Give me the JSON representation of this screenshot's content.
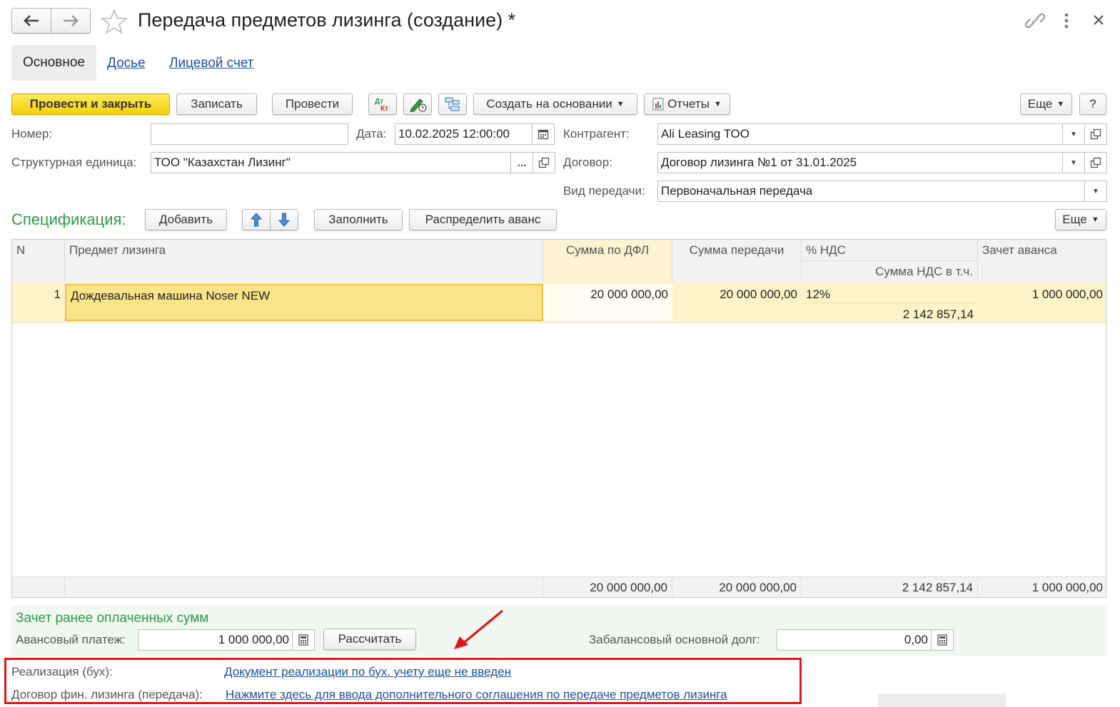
{
  "window": {
    "title": "Передача предметов лизинга (создание) *"
  },
  "tabs": [
    {
      "label": "Основное"
    },
    {
      "label": "Досье"
    },
    {
      "label": "Лицевой счет"
    }
  ],
  "toolbar": {
    "post_close": "Провести и закрыть",
    "save": "Записать",
    "post": "Провести",
    "create_based": "Создать на основании",
    "reports": "Отчеты",
    "more": "Еще",
    "help": "?"
  },
  "form": {
    "number_label": "Номер:",
    "number_value": "",
    "date_label": "Дата:",
    "date_value": "10.02.2025 12:00:00",
    "unit_label": "Структурная единица:",
    "unit_value": "ТОО \"Казахстан Лизинг\"",
    "counterparty_label": "Контрагент:",
    "counterparty_value": "Ali Leasing ТОО",
    "contract_label": "Договор:",
    "contract_value": "Договор лизинга №1 от 31.01.2025",
    "transfer_type_label": "Вид передачи:",
    "transfer_type_value": "Первоначальная передача"
  },
  "spec": {
    "title": "Спецификация:",
    "add": "Добавить",
    "fill": "Заполнить",
    "distribute": "Распределить аванс",
    "more": "Еще",
    "columns": {
      "n": "N",
      "item": "Предмет лизинга",
      "dfl": "Сумма по ДФЛ",
      "transfer": "Сумма передачи",
      "vat_pct": "% НДС",
      "vat_sum": "Сумма НДС в т.ч.",
      "advance": "Зачет аванса"
    },
    "rows": [
      {
        "n": "1",
        "item": "Дождевальная машина Noser NEW",
        "dfl": "20 000 000,00",
        "transfer": "20 000 000,00",
        "vat_pct": "12%",
        "vat_sum": "2 142 857,14",
        "advance": "1 000 000,00"
      }
    ],
    "totals": {
      "dfl": "20 000 000,00",
      "transfer": "20 000 000,00",
      "vat_sum": "2 142 857,14",
      "advance": "1 000 000,00"
    }
  },
  "offset": {
    "title": "Зачет ранее оплаченных сумм",
    "advance_label": "Авансовый платеж:",
    "advance_value": "1 000 000,00",
    "calc": "Рассчитать",
    "offbalance_label": "Забалансовый основной долг:",
    "offbalance_value": "0,00"
  },
  "footer": {
    "realization_label": "Реализация (бух):",
    "realization_link": "Документ реализации по бух. учету еще не введен",
    "contract_label": "Договор фин. лизинга (передача):",
    "contract_link": "Нажмите здесь для ввода дополнительного соглашения по передаче предметов лизинга"
  },
  "colors": {
    "accent_green": "#2e9a48",
    "primary_yellow": "#f5d20c",
    "link_blue": "#1f4e9c",
    "highlight_red": "#e0161b"
  }
}
